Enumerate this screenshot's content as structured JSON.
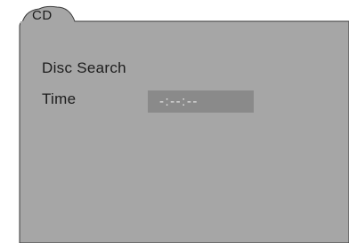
{
  "tab": {
    "label": "CD"
  },
  "menu": {
    "disc_search_label": "Disc Search",
    "time_label": "Time",
    "time_value": "-:--:--"
  },
  "colors": {
    "panel": "#a6a6a6",
    "field": "#8a8a8a",
    "outline": "#3a3a3a"
  }
}
